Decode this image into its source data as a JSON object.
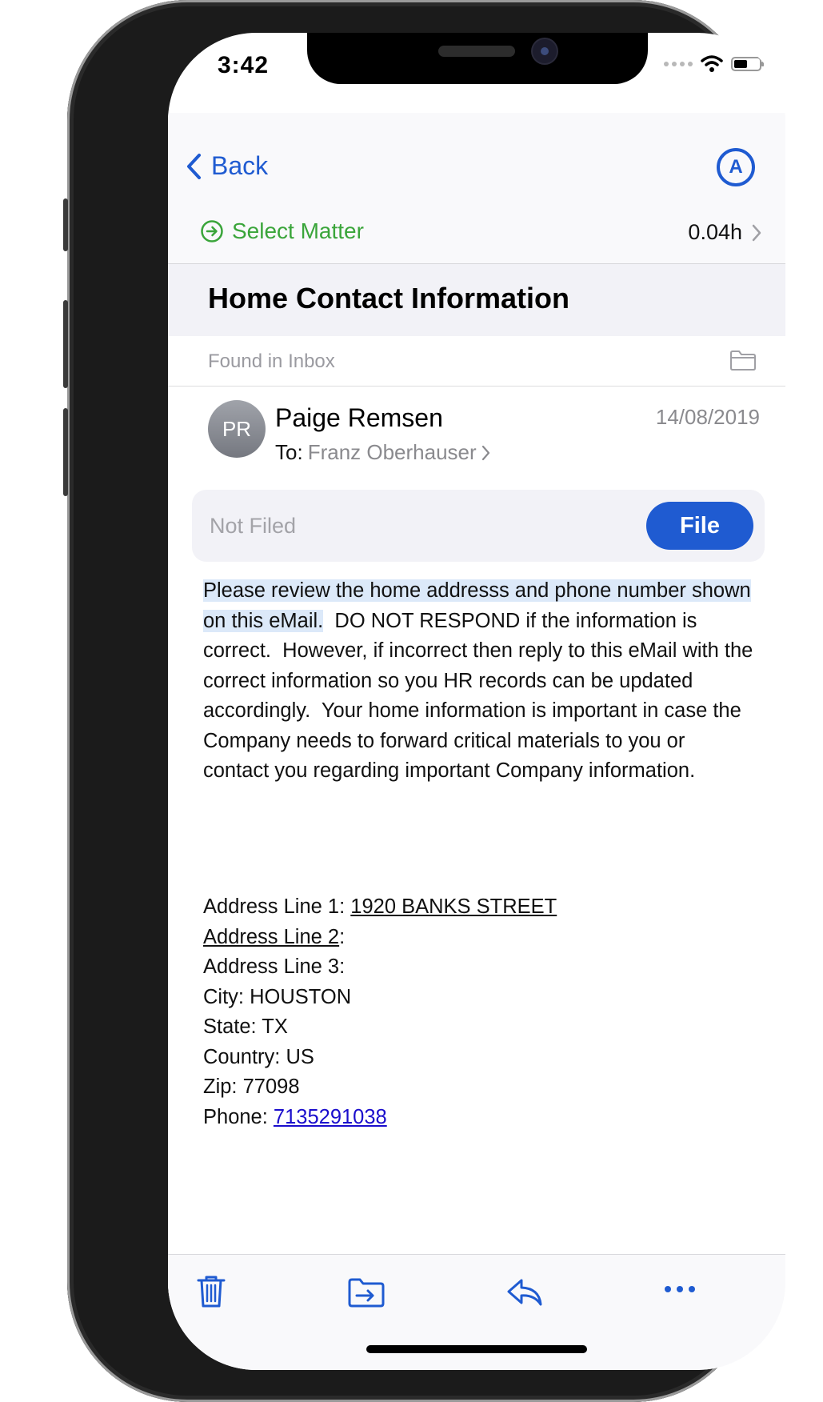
{
  "status_bar": {
    "time": "3:42"
  },
  "nav": {
    "back_label": "Back",
    "account_letter": "A"
  },
  "matter": {
    "label": "Select Matter",
    "time": "0.04h"
  },
  "email": {
    "subject": "Home Contact Information",
    "folder_label": "Found in Inbox",
    "sender_initials": "PR",
    "sender_name": "Paige Remsen",
    "to_prefix": "To:",
    "recipient": "Franz Oberhauser",
    "date": "14/08/2019",
    "filing_status": "Not Filed",
    "file_button": "File",
    "body_highlight": "Please review the home addresss and phone number shown on this eMail.",
    "body_rest": "  DO NOT RESPOND if the information is correct.  However, if incorrect then reply to this eMail with the correct information so you HR records can be updated accordingly.  Your home information is important in case the Company needs to forward critical materials to you or contact you regarding important Company information.",
    "address": {
      "line1_label": "Address Line 1: ",
      "line1_value": "1920 BANKS STREET",
      "line2_label": "Address Line 2",
      "line2_suffix": ":",
      "line3": "Address Line 3:",
      "city": "City: HOUSTON",
      "state": "State: TX",
      "country": "Country: US",
      "zip": "Zip: 77098",
      "phone_label": "Phone: ",
      "phone_value": "7135291038"
    }
  },
  "toolbar": {
    "icons": [
      "trash-icon",
      "move-to-folder-icon",
      "reply-icon",
      "more-icon"
    ]
  },
  "colors": {
    "accent": "#1f5bd1",
    "matter_green": "#3aa53a",
    "highlight": "#dce9f9",
    "link": "#1a0dcc"
  }
}
